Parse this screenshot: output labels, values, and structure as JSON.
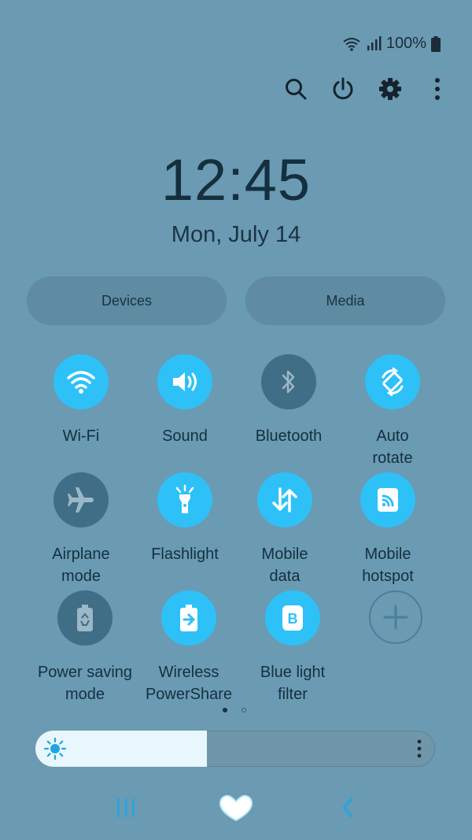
{
  "status_bar": {
    "battery_text": "100%",
    "icons": [
      "wifi-icon",
      "signal-icon",
      "battery-icon"
    ]
  },
  "top_actions": [
    "search-icon",
    "power-icon",
    "gear-icon",
    "more-vertical-icon"
  ],
  "clock": {
    "time": "12:45",
    "date": "Mon, July 14"
  },
  "panel_buttons": {
    "devices": "Devices",
    "media": "Media"
  },
  "tiles": [
    {
      "label_1": "Wi-Fi",
      "label_2": "",
      "icon": "wifi-icon",
      "state": "on"
    },
    {
      "label_1": "Sound",
      "label_2": "",
      "icon": "speaker-icon",
      "state": "on"
    },
    {
      "label_1": "Bluetooth",
      "label_2": "",
      "icon": "bluetooth-icon",
      "state": "off"
    },
    {
      "label_1": "Auto",
      "label_2": "rotate",
      "icon": "rotate-icon",
      "state": "on"
    },
    {
      "label_1": "Airplane",
      "label_2": "mode",
      "icon": "airplane-icon",
      "state": "off"
    },
    {
      "label_1": "Flashlight",
      "label_2": "",
      "icon": "flashlight-icon",
      "state": "on"
    },
    {
      "label_1": "Mobile",
      "label_2": "data",
      "icon": "mobile-data-icon",
      "state": "on"
    },
    {
      "label_1": "Mobile",
      "label_2": "hotspot",
      "icon": "hotspot-icon",
      "state": "on"
    },
    {
      "label_1": "Power saving",
      "label_2": "mode",
      "icon": "power-saving-icon",
      "state": "off"
    },
    {
      "label_1": "Wireless",
      "label_2": "PowerShare",
      "icon": "wireless-powershare-icon",
      "state": "on"
    },
    {
      "label_1": "Blue light",
      "label_2": "filter",
      "icon": "blue-light-filter-icon",
      "state": "on"
    }
  ],
  "add_tile": {
    "icon": "plus-icon"
  },
  "page_indicator": {
    "current": 1,
    "total": 2
  },
  "brightness": {
    "level": 0.43
  },
  "navigation": [
    "recents-icon",
    "home-icon",
    "back-icon"
  ],
  "colors": {
    "background": "#6b9ab3",
    "tile_on": "#2dc1f8",
    "tile_off": "#3f6e86",
    "text": "#13303f"
  }
}
